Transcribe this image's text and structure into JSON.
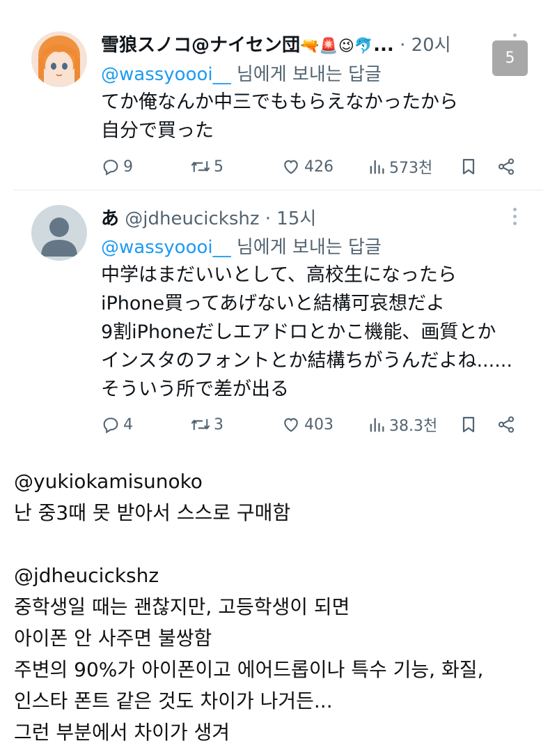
{
  "colors": {
    "link_blue": "#1d9bf0",
    "muted_gray": "#536471",
    "badge_gray": "#a8a8a8"
  },
  "page_badge": "5",
  "tweets": [
    {
      "display_name": "雪狼スノコ@ナイセン団",
      "name_emojis": [
        "🔫",
        "🚨",
        "😉",
        "🐬"
      ],
      "name_truncation": "...",
      "time": "· 20시",
      "reply_to_handle": "@wassyoooi__",
      "reply_to_suffix": " 님에게 보내는 답글",
      "lines": [
        "てか俺なんか中三でももらえなかったから",
        "自分で買った"
      ],
      "replies": "9",
      "retweets": "5",
      "likes": "426",
      "views": "573천"
    },
    {
      "display_name": "あ",
      "handle": "@jdheucickshz",
      "time": "· 15시",
      "reply_to_handle": "@wassyoooi__",
      "reply_to_suffix": " 님에게 보내는 답글",
      "lines": [
        "中学はまだいいとして、高校生になったら",
        "iPhone買ってあげないと結構可哀想だよ",
        "9割iPhoneだしエアドロとかこ機能、画質とか",
        "インスタのフォントとか結構ちがうんだよね......",
        "そういう所で差が出る"
      ],
      "replies": "4",
      "retweets": "3",
      "likes": "403",
      "views": "38.3천"
    }
  ],
  "translation": {
    "lines": [
      "@yukiokamisunoko",
      "난 중3때 못 받아서 스스로 구매함",
      "",
      "@jdheucickshz",
      "중학생일 때는 괜찮지만, 고등학생이 되면",
      "아이폰 안 사주면 불쌍함",
      "주변의 90%가 아이폰이고 에어드롭이나 특수 기능, 화질,",
      "인스타 폰트 같은 것도 차이가 나거든...",
      "그런 부분에서 차이가 생겨"
    ]
  }
}
